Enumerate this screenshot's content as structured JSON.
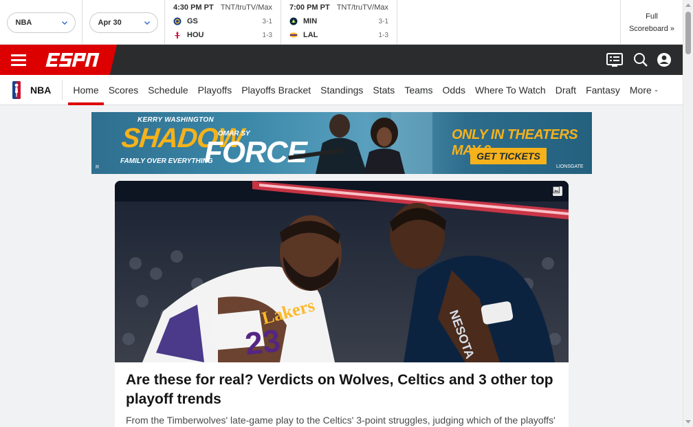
{
  "scoreboard": {
    "league_select": "NBA",
    "date_select": "Apr 30",
    "games": [
      {
        "time": "4:30 PM PT",
        "network": "TNT/truTV/Max",
        "teams": [
          {
            "abbr": "GS",
            "record": "3-1",
            "logo": "warriors-logo"
          },
          {
            "abbr": "HOU",
            "record": "1-3",
            "logo": "rockets-logo"
          }
        ]
      },
      {
        "time": "7:00 PM PT",
        "network": "TNT/truTV/Max",
        "teams": [
          {
            "abbr": "MIN",
            "record": "3-1",
            "logo": "timberwolves-logo"
          },
          {
            "abbr": "LAL",
            "record": "1-3",
            "logo": "lakers-logo"
          }
        ]
      }
    ],
    "full_scoreboard": {
      "line1": "Full",
      "line2": "Scoreboard »"
    }
  },
  "header": {
    "logo_text": "ESPN",
    "icons": [
      "scores-icon",
      "search-icon",
      "profile-icon"
    ]
  },
  "subnav": {
    "brand": "NBA",
    "items": [
      "Home",
      "Scores",
      "Schedule",
      "Playoffs",
      "Playoffs Bracket",
      "Standings",
      "Stats",
      "Teams",
      "Odds",
      "Where To Watch",
      "Draft",
      "Fantasy",
      "More"
    ],
    "active": "Home"
  },
  "ad": {
    "star_top": "KERRY WASHINGTON",
    "title": "SHADOW",
    "star_second": "OMAR SY",
    "title2": "FORCE",
    "tagline": "FAMILY OVER EVERYTHING",
    "release": "ONLY IN THEATERS MAY 9",
    "cta": "GET TICKETS",
    "studio": "LIONSGATE",
    "rating": "R"
  },
  "hero": {
    "title": "Are these for real? Verdicts on Wolves, Celtics and 3 other top playoff trends",
    "description": "From the Timberwolves' late-game play to the Celtics' 3-point struggles, judging which of the playoffs'"
  },
  "colors": {
    "espn_red": "#dd0000",
    "header_dark": "#2b2c2d",
    "ad_gold": "#f6b21b"
  }
}
